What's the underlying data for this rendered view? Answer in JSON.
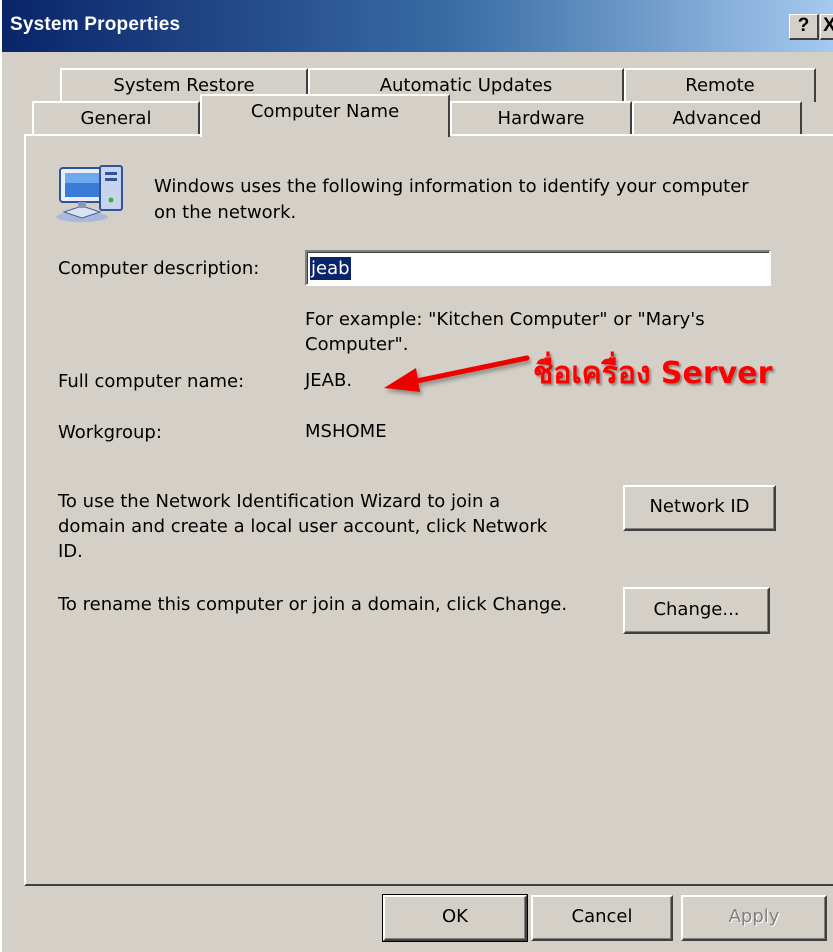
{
  "window": {
    "title": "System Properties",
    "help_label": "?",
    "close_label": "X"
  },
  "tabs": {
    "row1": [
      "System Restore",
      "Automatic Updates",
      "Remote"
    ],
    "row2": [
      "General",
      "Computer Name",
      "Hardware",
      "Advanced"
    ],
    "active": "Computer Name"
  },
  "computer_name": {
    "intro": "Windows uses the following information to identify your computer on the network.",
    "intro_line1": "Windows uses the following information to identify your computer",
    "intro_line2": "on the network.",
    "description_label": "Computer description:",
    "description_value": "jeab",
    "example_line1": "For example: \"Kitchen Computer\" or \"Mary's",
    "example_line2": "Computer\".",
    "full_name_label": "Full computer name:",
    "full_name_value": "JEAB.",
    "workgroup_label": "Workgroup:",
    "workgroup_value": "MSHOME",
    "network_id_line1": "To use the Network Identification Wizard to join a",
    "network_id_line2": "domain and create a local user account, click Network",
    "network_id_line3": "ID.",
    "network_id_button": "Network ID",
    "rename_text": "To rename this computer or join a domain, click Change.",
    "change_button": "Change..."
  },
  "annotation": {
    "text": "ชื่อเครื่อง Server",
    "color": "#ff0000"
  },
  "footer": {
    "ok_label": "OK",
    "cancel_label": "Cancel",
    "apply_label": "Apply"
  },
  "colors": {
    "title_bar_start": "#0a246a",
    "title_bar_end": "#a6caf0",
    "face": "#d4d0c8",
    "selection": "#0a246a"
  },
  "icons": {
    "computer": "computer-network-icon",
    "arrow": "red-arrow-icon"
  }
}
